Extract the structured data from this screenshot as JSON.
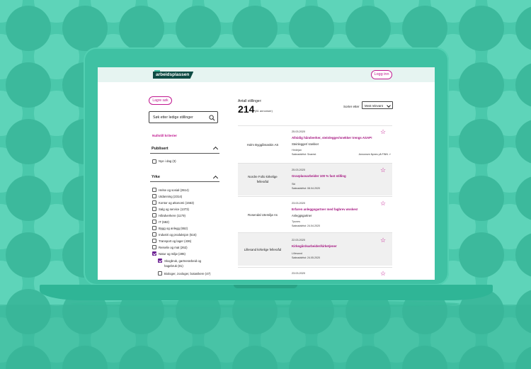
{
  "colors": {
    "background": "#4ac8ab",
    "laptop": "#3fc1a3",
    "accent": "#c0178f",
    "logo": "#0f4b44",
    "topbar": "#e6f4f1"
  },
  "header": {
    "logo_text": "arbeidsplassen",
    "login_label": "Logg inn"
  },
  "sidebar": {
    "save_search_label": "Lagre søk",
    "search_placeholder": "Søk etter ledige stillinger",
    "search_icon": "search-icon",
    "reset_label": "Nullstill kriterier",
    "published": {
      "title": "Publisert",
      "options": [
        {
          "label": "Nye i dag (3)",
          "checked": false
        }
      ]
    },
    "occupation": {
      "title": "Yrke",
      "options": [
        {
          "label": "Helse og sosial (2614)",
          "checked": false
        },
        {
          "label": "Utdanning (2314)",
          "checked": false
        },
        {
          "label": "Kontor og økonomi (1563)",
          "checked": false
        },
        {
          "label": "Salg og service (1373)",
          "checked": false
        },
        {
          "label": "Håndverkere (1179)",
          "checked": false
        },
        {
          "label": "IT (682)",
          "checked": false
        },
        {
          "label": "Bygg og anlegg (552)",
          "checked": false
        },
        {
          "label": "Industri og produksjon (516)",
          "checked": false
        },
        {
          "label": "Transport og lager (436)",
          "checked": false
        },
        {
          "label": "Reiseliv og mat (262)",
          "checked": false
        },
        {
          "label": "Natur og miljø (285)",
          "checked": true
        }
      ],
      "sub_options": [
        {
          "label": "Skogbruk, gartnerarbeid og",
          "label2": "hagebruk (81)",
          "checked": true
        },
        {
          "label": "Biologer, zoologer, botanikere (47)",
          "checked": false
        }
      ]
    }
  },
  "results": {
    "count_label": "Antall stillinger:",
    "count": "214",
    "count_note": "(81 annonser)",
    "sort_label": "Sorter etter",
    "sort_value": "Mest relevant",
    "jobs": [
      {
        "employer": "Holm Byggåmaskin AS",
        "employer2": "",
        "date": "25.03.2020",
        "title": "Allsidig håndverker, steinlegger/snekker trengs ASAP!",
        "subtitle": "Steinlegger/ snekker",
        "location": "Hedejan",
        "deadline": "Søknadsfrist: Snarest",
        "extra": "Annonsen åpnes på FINN ↗"
      },
      {
        "employer": "Nordre Follo kirkelige",
        "employer2": "fellesråd",
        "date": "25.03.2020",
        "title": "Gravplassarbeider 100 % fast stilling",
        "subtitle": "",
        "location": "Ski",
        "deadline": "Søknadsfrist: 08.04.2020",
        "extra": ""
      },
      {
        "employer": "Rosendal Utemiljø As",
        "employer2": "",
        "date": "23.03.2020",
        "title": "Erfaren anleggsgartner med fagbrev ønskes!",
        "subtitle": "Anleggsgartner",
        "location": "Tysnes",
        "deadline": "Søknadsfrist: 24.04.2020",
        "extra": ""
      },
      {
        "employer": "Lillesand kirkelige fellesråd",
        "employer2": "",
        "date": "22.03.2020",
        "title": "Kirkegårdsarbeider/kirketjener",
        "subtitle": "",
        "location": "Lillesand",
        "deadline": "Søknadsfrist: 24.05.2020",
        "extra": ""
      },
      {
        "employer": "",
        "employer2": "",
        "date": "23.03.2020",
        "title": "",
        "subtitle": "",
        "location": "",
        "deadline": "",
        "extra": ""
      }
    ]
  }
}
